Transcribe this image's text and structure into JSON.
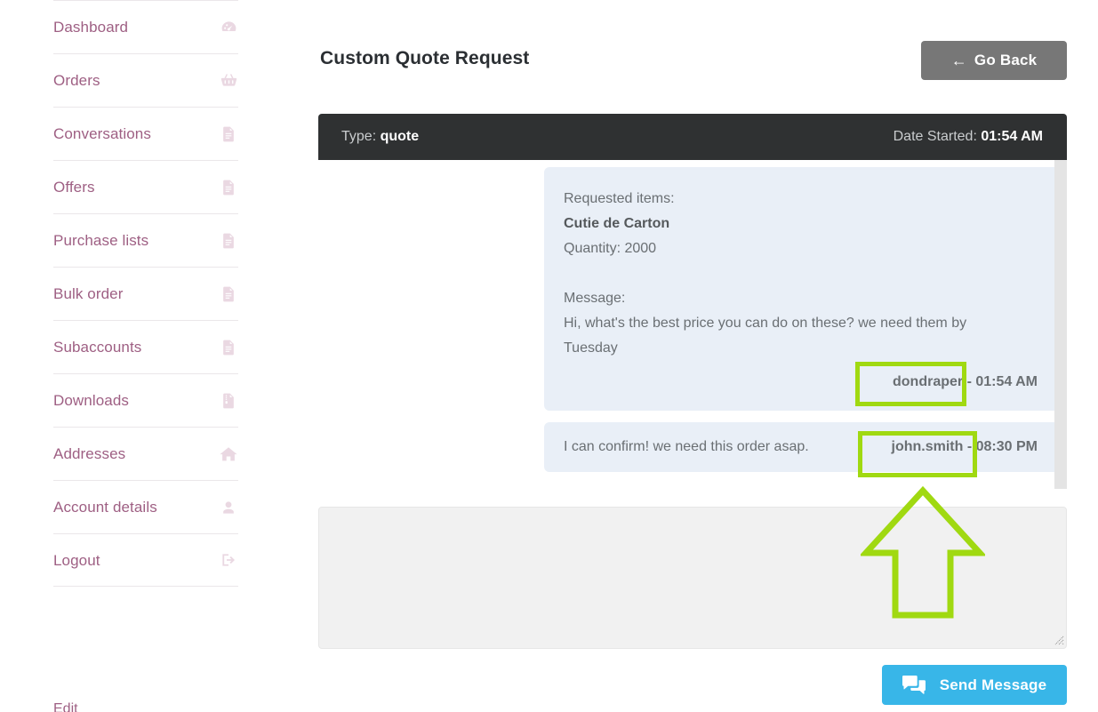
{
  "sidebar": {
    "items": [
      {
        "label": "Dashboard",
        "icon": "dashboard-gauge-icon"
      },
      {
        "label": "Orders",
        "icon": "shopping-basket-icon"
      },
      {
        "label": "Conversations",
        "icon": "document-icon"
      },
      {
        "label": "Offers",
        "icon": "document-icon"
      },
      {
        "label": "Purchase lists",
        "icon": "document-icon"
      },
      {
        "label": "Bulk order",
        "icon": "document-icon"
      },
      {
        "label": "Subaccounts",
        "icon": "document-icon"
      },
      {
        "label": "Downloads",
        "icon": "document-download-icon"
      },
      {
        "label": "Addresses",
        "icon": "home-icon"
      },
      {
        "label": "Account details",
        "icon": "user-icon"
      },
      {
        "label": "Logout",
        "icon": "logout-icon"
      }
    ],
    "footer_text": "Edit"
  },
  "header": {
    "title": "Custom Quote Request",
    "go_back_label": "Go Back",
    "go_back_arrow": "←"
  },
  "thread": {
    "type_label": "Type:",
    "type_value": "quote",
    "date_label": "Date Started:",
    "date_value": "01:54 AM",
    "messages": [
      {
        "requested_items_label": "Requested items:",
        "item_name": "Cutie de Carton",
        "quantity_line": "Quantity: 2000",
        "message_label": "Message:",
        "body_line_1": "Hi, what's the best price you can do on these? we need them by",
        "body_line_2": "Tuesday",
        "author": "dondraper",
        "separator": " - ",
        "time": "01:54 AM"
      },
      {
        "text": "I can confirm! we need this order asap.",
        "author": "john.smith",
        "separator": " - ",
        "time": "08:30 PM"
      }
    ]
  },
  "compose": {
    "value": "",
    "placeholder": "",
    "send_label": "Send Message"
  },
  "colors": {
    "accent_blue": "#38b6e8",
    "go_back_gray": "#777777",
    "thread_header_dark": "#2f3132",
    "bubble_blue": "#e9eff7",
    "sidebar_link": "#9e5f83",
    "annotation_green": "#a0d911"
  },
  "annotations": {
    "box_1_target": "dondraper",
    "box_2_target": "john.smith",
    "arrow_direction": "up"
  }
}
